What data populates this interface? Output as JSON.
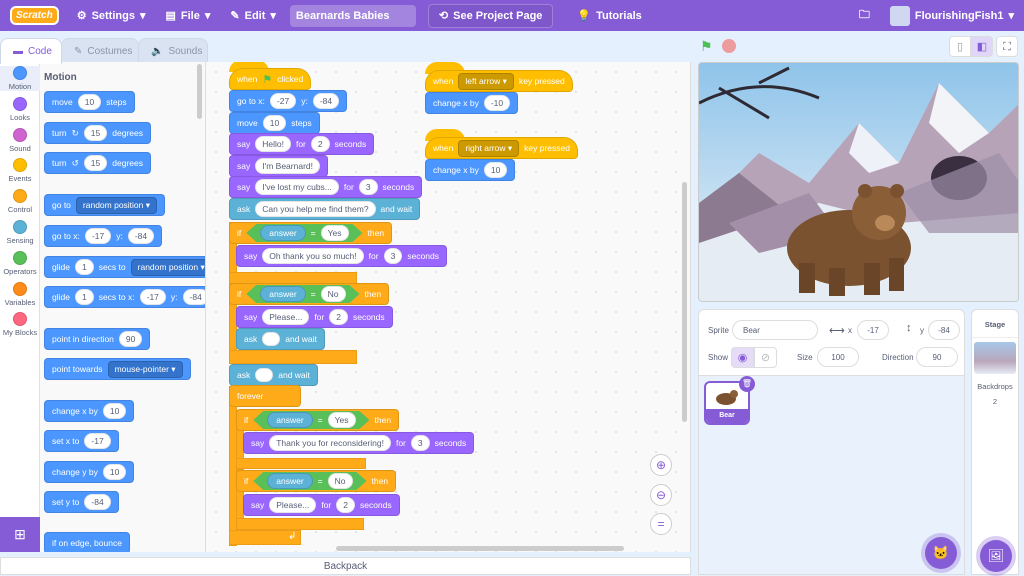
{
  "menu": {
    "logo": "Scratch",
    "settings": "Settings",
    "file": "File",
    "edit": "Edit",
    "project_title": "Bearnards Babies",
    "see_project": "See Project Page",
    "tutorials": "Tutorials",
    "username": "FlourishingFish1"
  },
  "tabs": [
    {
      "label": "Code",
      "active": true
    },
    {
      "label": "Costumes"
    },
    {
      "label": "Sounds"
    }
  ],
  "categories": [
    {
      "label": "Motion",
      "color": "#4C97FF"
    },
    {
      "label": "Looks",
      "color": "#9966FF"
    },
    {
      "label": "Sound",
      "color": "#CF63CF"
    },
    {
      "label": "Events",
      "color": "#FFBF00"
    },
    {
      "label": "Control",
      "color": "#FFAB19"
    },
    {
      "label": "Sensing",
      "color": "#5CB1D6"
    },
    {
      "label": "Operators",
      "color": "#59C059"
    },
    {
      "label": "Variables",
      "color": "#FF8C1A"
    },
    {
      "label": "My Blocks",
      "color": "#FF6680"
    }
  ],
  "colors": {
    "motion": "#4C97FF",
    "looks": "#9966FF",
    "events": "#FFBF00",
    "control": "#FFAB19",
    "sensing": "#5CB1D6",
    "operators": "#59C059",
    "accent": "#855CD6"
  },
  "palette": {
    "heading": "Motion",
    "blocks": [
      {
        "cat": "motion",
        "parts": [
          {
            "k": "t",
            "v": "move"
          },
          {
            "k": "n",
            "v": "10"
          },
          {
            "k": "t",
            "v": "steps"
          }
        ]
      },
      {
        "cat": "motion",
        "parts": [
          {
            "k": "t",
            "v": "turn"
          },
          {
            "k": "t",
            "v": "↻"
          },
          {
            "k": "n",
            "v": "15"
          },
          {
            "k": "t",
            "v": "degrees"
          }
        ]
      },
      {
        "cat": "motion",
        "parts": [
          {
            "k": "t",
            "v": "turn"
          },
          {
            "k": "t",
            "v": "↺"
          },
          {
            "k": "n",
            "v": "15"
          },
          {
            "k": "t",
            "v": "degrees"
          }
        ]
      },
      {
        "cat": "motion",
        "parts": [
          {
            "k": "t",
            "v": "go to"
          },
          {
            "k": "d",
            "v": "random position"
          }
        ]
      },
      {
        "cat": "motion",
        "parts": [
          {
            "k": "t",
            "v": "go to x:"
          },
          {
            "k": "n",
            "v": "-17"
          },
          {
            "k": "t",
            "v": "y:"
          },
          {
            "k": "n",
            "v": "-84"
          }
        ]
      },
      {
        "cat": "motion",
        "parts": [
          {
            "k": "t",
            "v": "glide"
          },
          {
            "k": "n",
            "v": "1"
          },
          {
            "k": "t",
            "v": "secs to"
          },
          {
            "k": "d",
            "v": "random position"
          }
        ]
      },
      {
        "cat": "motion",
        "parts": [
          {
            "k": "t",
            "v": "glide"
          },
          {
            "k": "n",
            "v": "1"
          },
          {
            "k": "t",
            "v": "secs to x:"
          },
          {
            "k": "n",
            "v": "-17"
          },
          {
            "k": "t",
            "v": "y:"
          },
          {
            "k": "n",
            "v": "-84"
          }
        ]
      },
      {
        "cat": "motion",
        "parts": [
          {
            "k": "t",
            "v": "point in direction"
          },
          {
            "k": "n",
            "v": "90"
          }
        ]
      },
      {
        "cat": "motion",
        "parts": [
          {
            "k": "t",
            "v": "point towards"
          },
          {
            "k": "d",
            "v": "mouse-pointer"
          }
        ]
      },
      {
        "cat": "motion",
        "parts": [
          {
            "k": "t",
            "v": "change x by"
          },
          {
            "k": "n",
            "v": "10"
          }
        ]
      },
      {
        "cat": "motion",
        "parts": [
          {
            "k": "t",
            "v": "set x to"
          },
          {
            "k": "n",
            "v": "-17"
          }
        ]
      },
      {
        "cat": "motion",
        "parts": [
          {
            "k": "t",
            "v": "change y by"
          },
          {
            "k": "n",
            "v": "10"
          }
        ]
      },
      {
        "cat": "motion",
        "parts": [
          {
            "k": "t",
            "v": "set y to"
          },
          {
            "k": "n",
            "v": "-84"
          }
        ]
      },
      {
        "cat": "motion",
        "parts": [
          {
            "k": "t",
            "v": "if on edge, bounce"
          }
        ]
      }
    ]
  },
  "script": {
    "blocks": [
      {
        "cat": "events",
        "hat": true,
        "parts": [
          {
            "k": "t",
            "v": "when"
          },
          {
            "k": "flag",
            "v": "green-flag"
          },
          {
            "k": "t",
            "v": "clicked"
          }
        ]
      },
      {
        "cat": "motion",
        "parts": [
          {
            "k": "t",
            "v": "go to x:"
          },
          {
            "k": "n",
            "v": "-27"
          },
          {
            "k": "t",
            "v": "y:"
          },
          {
            "k": "n",
            "v": "-84"
          }
        ]
      },
      {
        "cat": "motion",
        "parts": [
          {
            "k": "t",
            "v": "move"
          },
          {
            "k": "n",
            "v": "10"
          },
          {
            "k": "t",
            "v": "steps"
          }
        ]
      },
      {
        "cat": "looks",
        "parts": [
          {
            "k": "t",
            "v": "say"
          },
          {
            "k": "n",
            "v": "Hello!"
          },
          {
            "k": "t",
            "v": "for"
          },
          {
            "k": "n",
            "v": "2"
          },
          {
            "k": "t",
            "v": "seconds"
          }
        ]
      },
      {
        "cat": "looks",
        "parts": [
          {
            "k": "t",
            "v": "say"
          },
          {
            "k": "n",
            "v": "I'm Bearnard!"
          }
        ]
      },
      {
        "cat": "looks",
        "parts": [
          {
            "k": "t",
            "v": "say"
          },
          {
            "k": "n",
            "v": "I've lost my cubs..."
          },
          {
            "k": "t",
            "v": "for"
          },
          {
            "k": "n",
            "v": "3"
          },
          {
            "k": "t",
            "v": "seconds"
          }
        ]
      },
      {
        "cat": "sensing",
        "parts": [
          {
            "k": "t",
            "v": "ask"
          },
          {
            "k": "n",
            "v": "Can you help me find them?"
          },
          {
            "k": "t",
            "v": "and wait"
          }
        ]
      },
      {
        "cat": "control",
        "parts": [
          {
            "k": "t",
            "v": "if"
          },
          {
            "k": "b",
            "l": "answer",
            "op": "=",
            "r": "Yes"
          },
          {
            "k": "t",
            "v": "then"
          }
        ]
      },
      {
        "cat": "looks",
        "parts": [
          {
            "k": "t",
            "v": "say"
          },
          {
            "k": "n",
            "v": "Oh thank you so much!"
          },
          {
            "k": "t",
            "v": "for"
          },
          {
            "k": "n",
            "v": "3"
          },
          {
            "k": "t",
            "v": "seconds"
          }
        ]
      },
      {
        "cat": "control",
        "parts": [
          {
            "k": "t",
            "v": "if"
          },
          {
            "k": "b",
            "l": "answer",
            "op": "=",
            "r": "No"
          },
          {
            "k": "t",
            "v": "then"
          }
        ]
      },
      {
        "cat": "looks",
        "parts": [
          {
            "k": "t",
            "v": "say"
          },
          {
            "k": "n",
            "v": "Please..."
          },
          {
            "k": "t",
            "v": "for"
          },
          {
            "k": "n",
            "v": "2"
          },
          {
            "k": "t",
            "v": "seconds"
          }
        ]
      },
      {
        "cat": "sensing",
        "parts": [
          {
            "k": "t",
            "v": "ask"
          },
          {
            "k": "n",
            "v": ""
          },
          {
            "k": "t",
            "v": "and wait"
          }
        ]
      },
      {
        "cat": "sensing",
        "parts": [
          {
            "k": "t",
            "v": "ask"
          },
          {
            "k": "n",
            "v": ""
          },
          {
            "k": "t",
            "v": "and wait"
          }
        ]
      },
      {
        "cat": "control",
        "parts": [
          {
            "k": "t",
            "v": "forever"
          }
        ]
      },
      {
        "cat": "control",
        "parts": [
          {
            "k": "t",
            "v": "if"
          },
          {
            "k": "b",
            "l": "answer",
            "op": "=",
            "r": "Yes"
          },
          {
            "k": "t",
            "v": "then"
          }
        ]
      },
      {
        "cat": "looks",
        "parts": [
          {
            "k": "t",
            "v": "say"
          },
          {
            "k": "n",
            "v": "Thank you for reconsidering!"
          },
          {
            "k": "t",
            "v": "for"
          },
          {
            "k": "n",
            "v": "3"
          },
          {
            "k": "t",
            "v": "seconds"
          }
        ]
      },
      {
        "cat": "control",
        "parts": [
          {
            "k": "t",
            "v": "if"
          },
          {
            "k": "b",
            "l": "answer",
            "op": "=",
            "r": "No"
          },
          {
            "k": "t",
            "v": "then"
          }
        ]
      },
      {
        "cat": "looks",
        "parts": [
          {
            "k": "t",
            "v": "say"
          },
          {
            "k": "n",
            "v": "Please..."
          },
          {
            "k": "t",
            "v": "for"
          },
          {
            "k": "n",
            "v": "2"
          },
          {
            "k": "t",
            "v": "seconds"
          }
        ]
      },
      {
        "cat": "events",
        "hat": true,
        "parts": [
          {
            "k": "t",
            "v": "when"
          },
          {
            "k": "d",
            "v": "left arrow"
          },
          {
            "k": "t",
            "v": "key pressed"
          }
        ]
      },
      {
        "cat": "motion",
        "parts": [
          {
            "k": "t",
            "v": "change x by"
          },
          {
            "k": "n",
            "v": "-10"
          }
        ]
      },
      {
        "cat": "events",
        "hat": true,
        "parts": [
          {
            "k": "t",
            "v": "when"
          },
          {
            "k": "d",
            "v": "right arrow"
          },
          {
            "k": "t",
            "v": "key pressed"
          }
        ]
      },
      {
        "cat": "motion",
        "parts": [
          {
            "k": "t",
            "v": "change x by"
          },
          {
            "k": "n",
            "v": "10"
          }
        ]
      }
    ]
  },
  "backpack": "Backpack",
  "sprite": {
    "label_sprite": "Sprite",
    "name": "Bear",
    "label_x": "x",
    "x": "-17",
    "label_y": "y",
    "y": "-84",
    "label_show": "Show",
    "label_size": "Size",
    "size": "100",
    "label_direction": "Direction",
    "direction": "90",
    "visible": true
  },
  "sprites": [
    {
      "name": "Bear",
      "selected": true
    }
  ],
  "stage_panel": {
    "title": "Stage",
    "backdrops_label": "Backdrops",
    "backdrops_count": "2"
  }
}
